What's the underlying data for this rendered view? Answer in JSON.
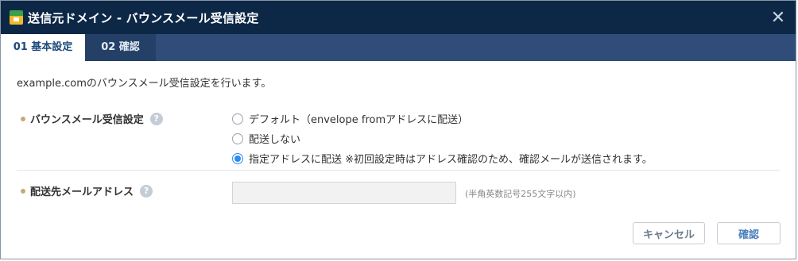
{
  "dialog": {
    "title": "送信元ドメイン - バウンスメール受信設定",
    "close_glyph": "✕"
  },
  "tabs": [
    {
      "label": "01 基本設定",
      "active": true
    },
    {
      "label": "02 確認",
      "active": false
    }
  ],
  "intro_text": "example.comのバウンスメール受信設定を行います。",
  "bounce_setting": {
    "label": "バウンスメール受信設定",
    "help_glyph": "?",
    "options": [
      {
        "label": "デフォルト（envelope fromアドレスに配送）",
        "checked": false
      },
      {
        "label": "配送しない",
        "checked": false
      },
      {
        "label": "指定アドレスに配送 ※初回設定時はアドレス確認のため、確認メールが送信されます。",
        "checked": true
      }
    ]
  },
  "destination": {
    "label": "配送先メールアドレス",
    "help_glyph": "?",
    "value": "",
    "hint": "(半角英数記号255文字以内)"
  },
  "buttons": {
    "cancel": "キャンセル",
    "confirm": "確認"
  },
  "colors": {
    "titlebar": "#0d2847",
    "tabbar": "#2f4d78",
    "radio_accent": "#2c8cf0"
  }
}
